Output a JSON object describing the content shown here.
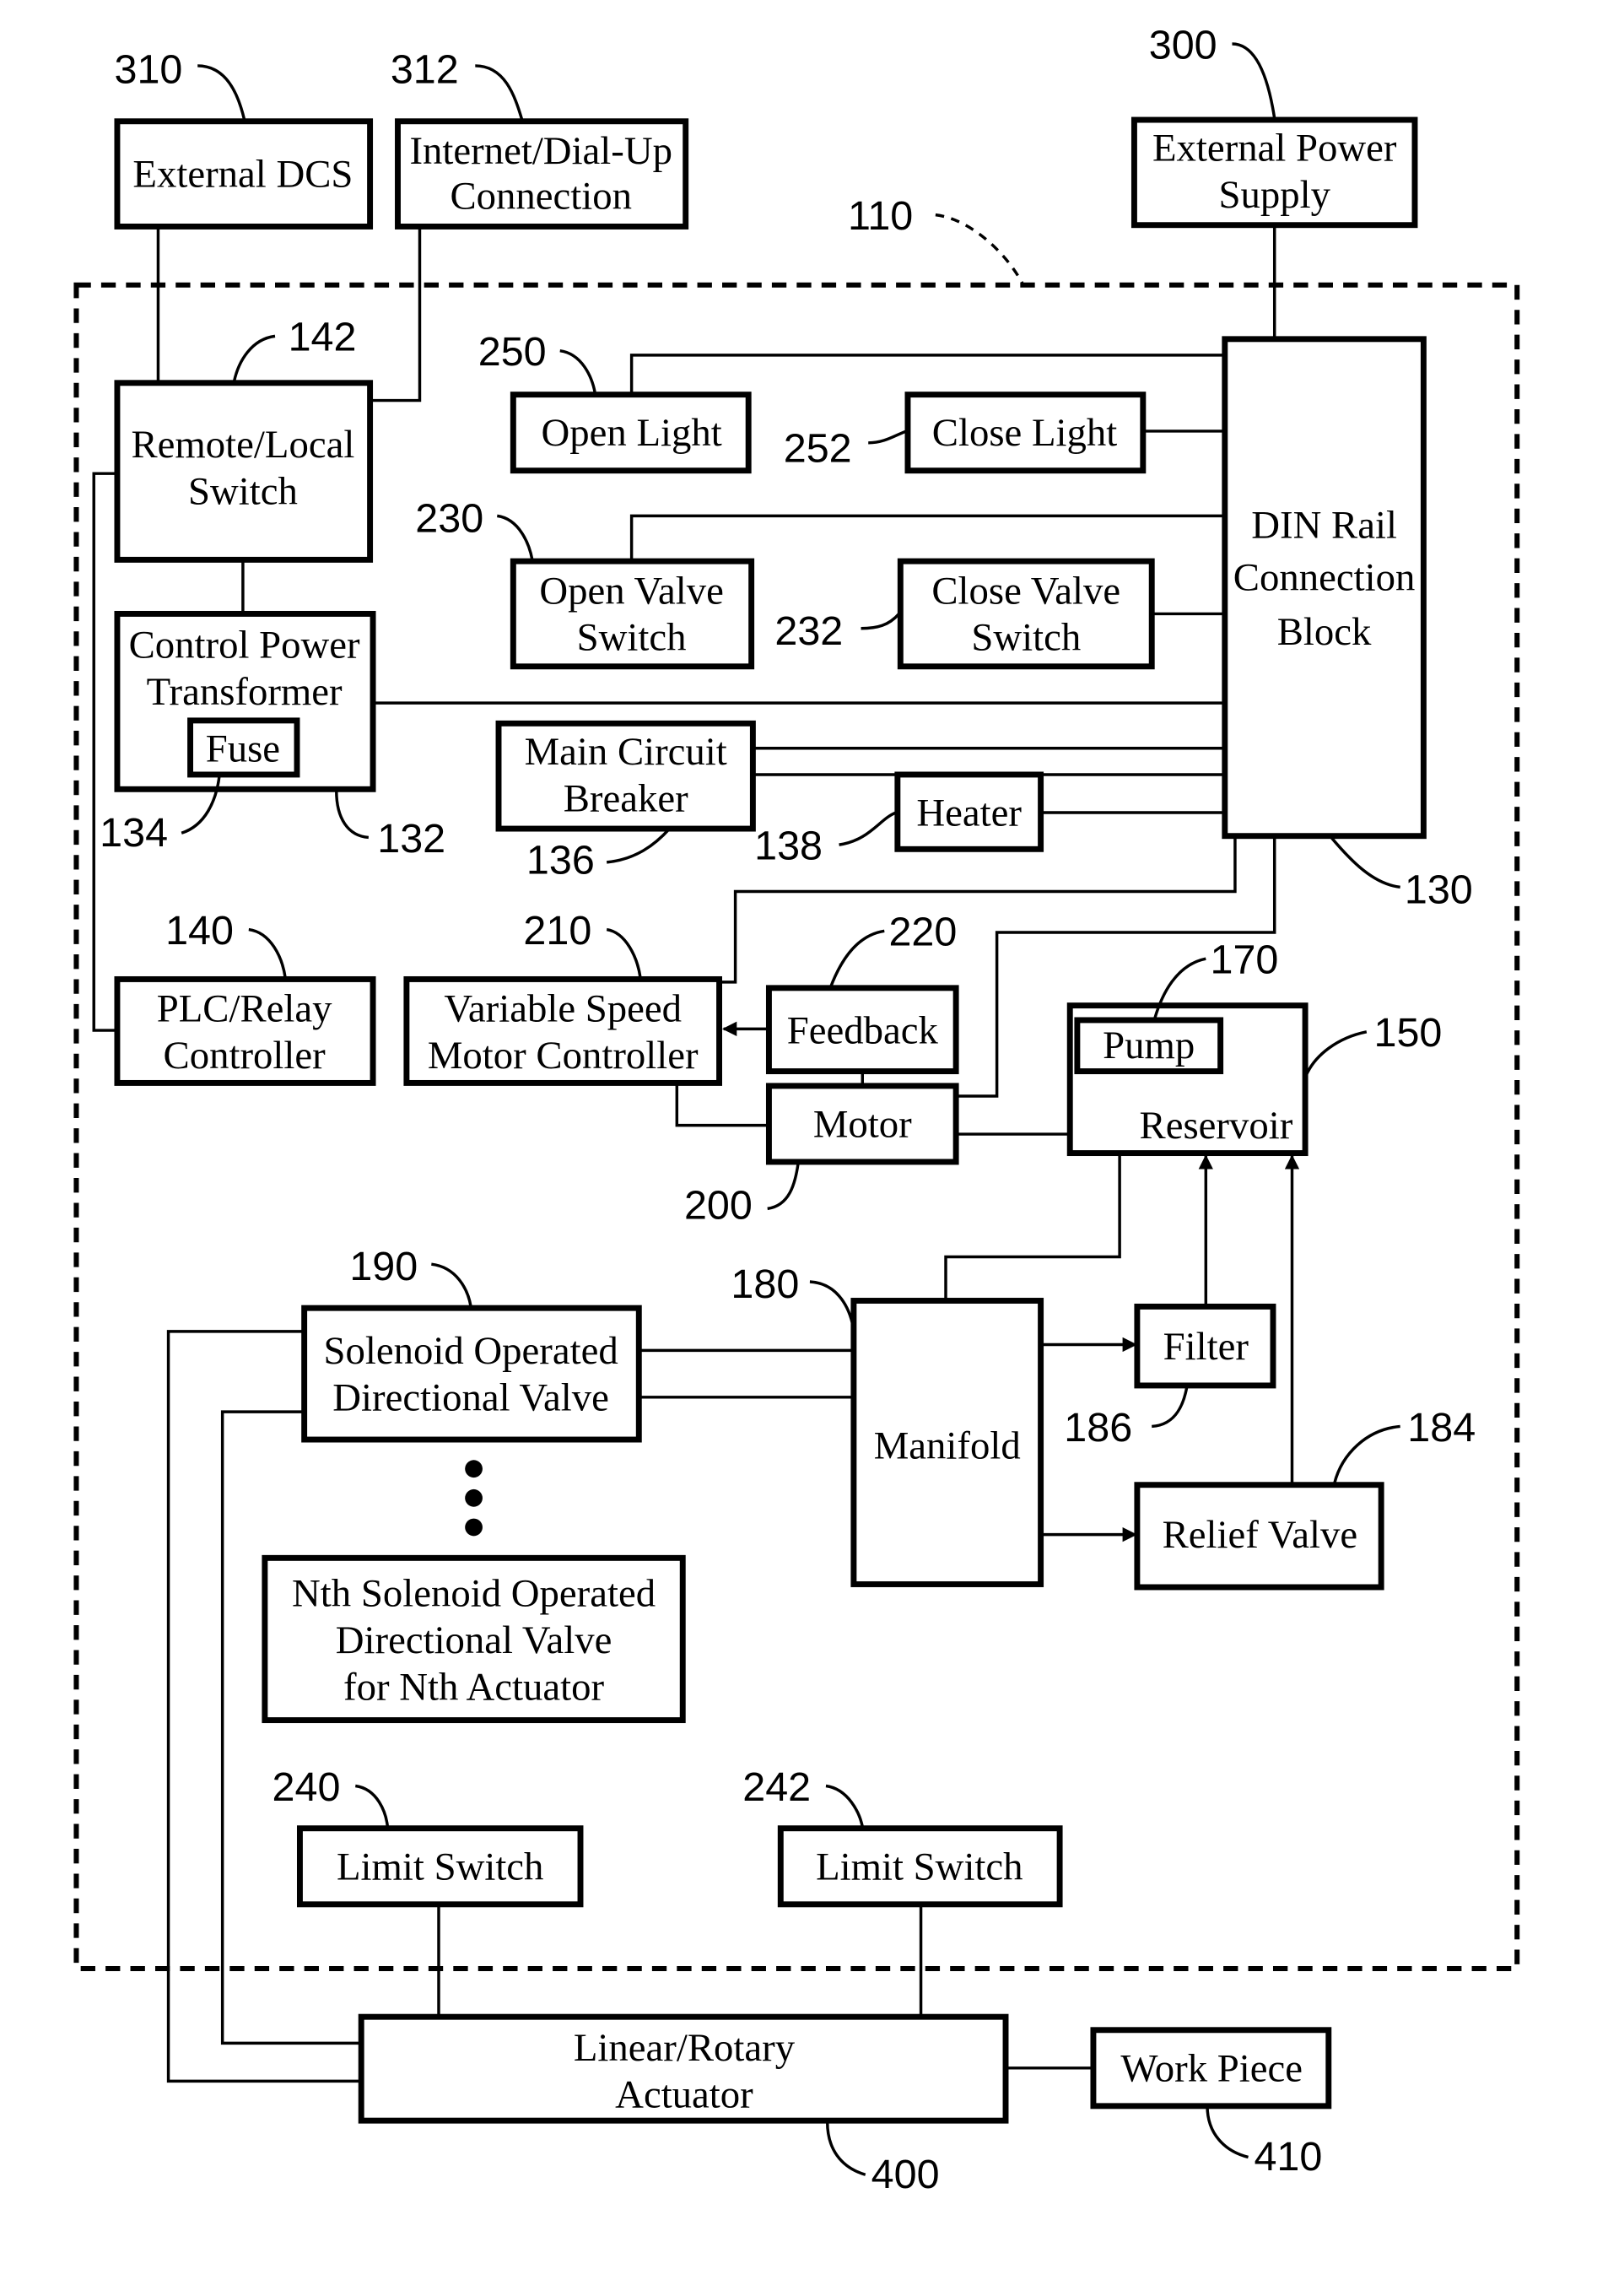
{
  "figure": {
    "enclosure_ref": "110",
    "blocks": {
      "external_dcs": {
        "label": [
          "External DCS"
        ],
        "ref": "310"
      },
      "internet": {
        "label": [
          "Internet/Dial-Up",
          "Connection"
        ],
        "ref": "312"
      },
      "ext_power": {
        "label": [
          "External Power",
          "Supply"
        ],
        "ref": "300"
      },
      "remote_local": {
        "label": [
          "Remote/Local",
          "Switch"
        ],
        "ref": "142"
      },
      "open_light": {
        "label": [
          "Open Light"
        ],
        "ref": "250"
      },
      "close_light": {
        "label": [
          "Close Light"
        ],
        "ref": "252"
      },
      "din_rail": {
        "label": [
          "DIN Rail",
          "Connection",
          "Block"
        ],
        "ref": "130"
      },
      "open_valve": {
        "label": [
          "Open Valve",
          "Switch"
        ],
        "ref": "230"
      },
      "close_valve": {
        "label": [
          "Close Valve",
          "Switch"
        ],
        "ref": "232"
      },
      "cpt": {
        "label": [
          "Control Power",
          "Transformer"
        ],
        "ref": "132"
      },
      "fuse": {
        "label": [
          "Fuse"
        ],
        "ref": "134"
      },
      "mcb": {
        "label": [
          "Main Circuit",
          "Breaker"
        ],
        "ref": "136"
      },
      "heater": {
        "label": [
          "Heater"
        ],
        "ref": "138"
      },
      "plc": {
        "label": [
          "PLC/Relay",
          "Controller"
        ],
        "ref": "140"
      },
      "vsmc": {
        "label": [
          "Variable Speed",
          "Motor Controller"
        ],
        "ref": "210"
      },
      "feedback": {
        "label": [
          "Feedback"
        ],
        "ref": "220"
      },
      "motor": {
        "label": [
          "Motor"
        ],
        "ref": "200"
      },
      "pump": {
        "label": [
          "Pump"
        ],
        "ref": "170"
      },
      "reservoir": {
        "label": [
          "Reservoir"
        ],
        "ref": "150"
      },
      "sodv": {
        "label": [
          "Solenoid Operated",
          "Directional Valve"
        ],
        "ref": "190"
      },
      "manifold": {
        "label": [
          "Manifold"
        ],
        "ref": "180"
      },
      "filter": {
        "label": [
          "Filter"
        ],
        "ref": "186"
      },
      "relief": {
        "label": [
          "Relief Valve"
        ],
        "ref": "184"
      },
      "nth_sodv": {
        "label": [
          "Nth Solenoid Operated",
          "Directional Valve",
          "for Nth Actuator"
        ]
      },
      "limit1": {
        "label": [
          "Limit Switch"
        ],
        "ref": "240"
      },
      "limit2": {
        "label": [
          "Limit Switch"
        ],
        "ref": "242"
      },
      "actuator": {
        "label": [
          "Linear/Rotary",
          "Actuator"
        ],
        "ref": "400"
      },
      "workpiece": {
        "label": [
          "Work Piece"
        ],
        "ref": "410"
      }
    }
  }
}
